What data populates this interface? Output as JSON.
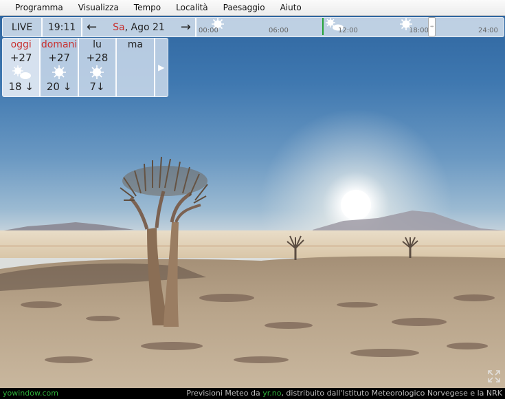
{
  "menu": [
    "Programma",
    "Visualizza",
    "Tempo",
    "Località",
    "Paesaggio",
    "Aiuto"
  ],
  "timebar": {
    "live_label": "LIVE",
    "clock": "19:11",
    "day_abbr": "Sa",
    "date_rest": ", Ago 21",
    "ticks": [
      "00:00",
      "06:00",
      "12:00",
      "18:00",
      "24:00"
    ]
  },
  "forecast": [
    {
      "day": "oggi",
      "temp": "+27",
      "icon": "sun-cloud-icon",
      "wind": "18",
      "highlight": true
    },
    {
      "day": "domani",
      "temp": "+27",
      "icon": "sun-icon",
      "wind": "20",
      "highlight": false
    },
    {
      "day": "lu",
      "temp": "+28",
      "icon": "sun-icon",
      "wind": "7",
      "highlight": false
    },
    {
      "day": "ma",
      "temp": "",
      "icon": "",
      "wind": "",
      "highlight": false
    }
  ],
  "status": {
    "site": "yowindow.com",
    "credits_prefix": "Previsioni Meteo da ",
    "credits_link": "yr.no",
    "credits_suffix": ", distribuito dall'Istituto Meteorologico Norvegese e la NRK"
  },
  "colors": {
    "accent_red": "#c8302f",
    "now_green": "#25a238",
    "link_green": "#2fb13a"
  }
}
